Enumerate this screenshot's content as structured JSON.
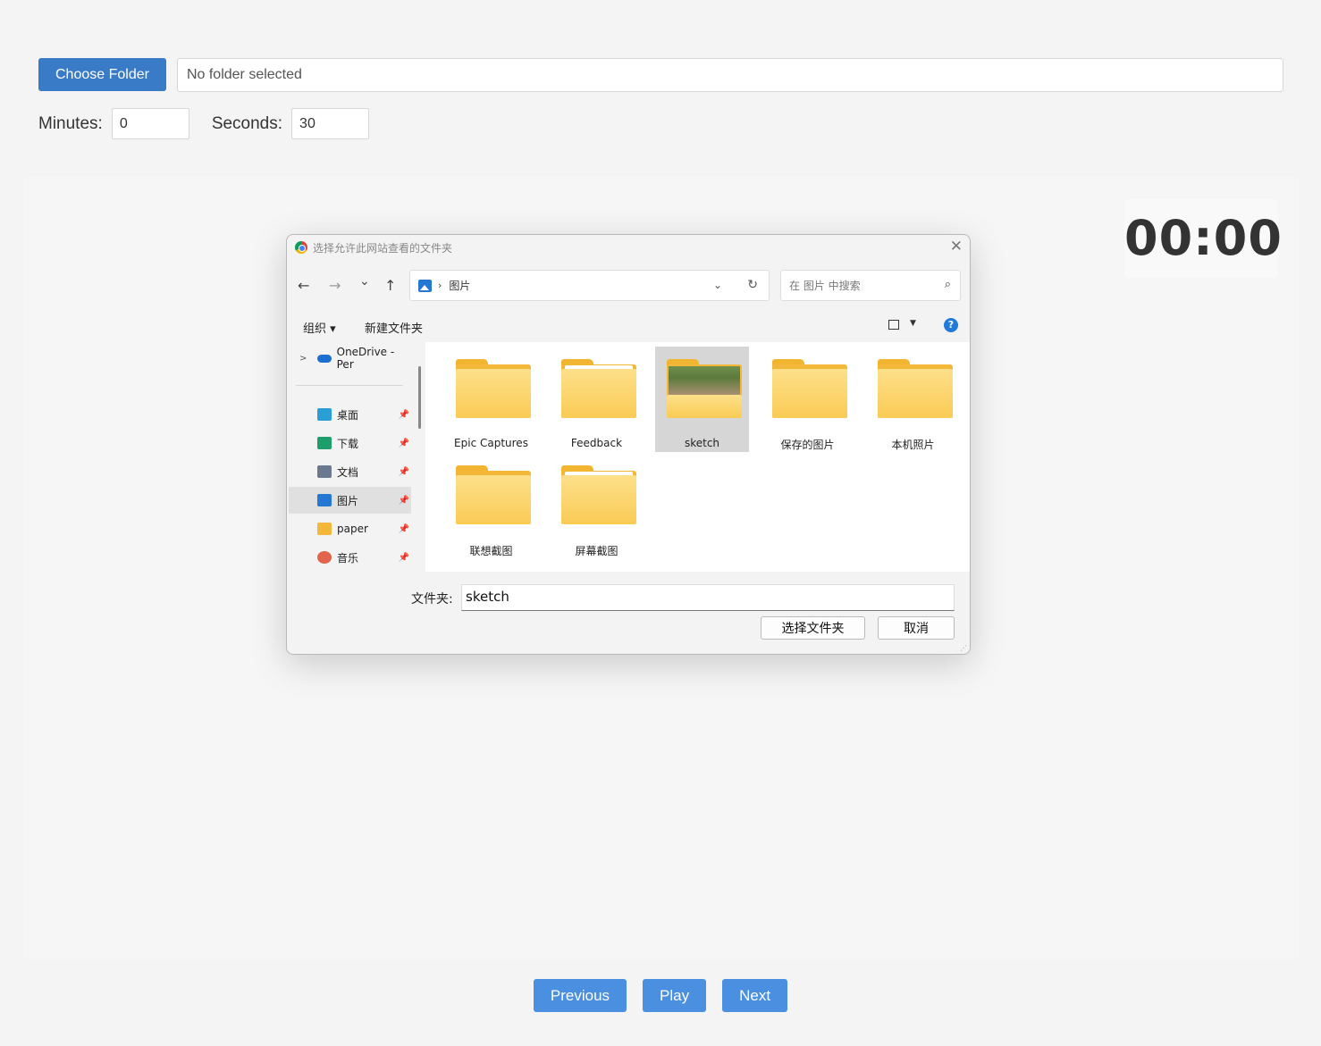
{
  "top": {
    "choose_folder_label": "Choose Folder",
    "folder_display": "No folder selected"
  },
  "time": {
    "minutes_label": "Minutes:",
    "minutes_value": "0",
    "seconds_label": "Seconds:",
    "seconds_value": "30"
  },
  "timer": {
    "value": "00:00"
  },
  "nav": {
    "previous": "Previous",
    "play": "Play",
    "next": "Next"
  },
  "dialog": {
    "title": "选择允许此网站查看的文件夹",
    "close_glyph": "✕",
    "nav_glyphs": {
      "back": "←",
      "forward": "→",
      "recent": "⌄",
      "up": "↑",
      "refresh": "↻",
      "search": "⌕",
      "chevron": "⌄"
    },
    "breadcrumb_sep": "›",
    "address": "图片",
    "search_placeholder": "在 图片 中搜索",
    "toolbar": {
      "organize": "组织 ▾",
      "new_folder": "新建文件夹",
      "help": "?"
    },
    "sidebar": {
      "onedrive": "OneDrive - Per",
      "items": [
        {
          "label": "桌面",
          "icon": "desktop-icon",
          "color": "#2a9fd6"
        },
        {
          "label": "下载",
          "icon": "download-icon",
          "color": "#1e9e6a"
        },
        {
          "label": "文档",
          "icon": "document-icon",
          "color": "#6b7a8f"
        },
        {
          "label": "图片",
          "icon": "pictures-icon",
          "color": "#2478d4"
        },
        {
          "label": "paper",
          "icon": "folder-icon",
          "color": "#f3b73a"
        },
        {
          "label": "音乐",
          "icon": "music-icon",
          "color": "#e0654b"
        }
      ]
    },
    "folders": [
      {
        "label": "Epic Captures",
        "type": "plain"
      },
      {
        "label": "Feedback",
        "type": "paper"
      },
      {
        "label": "sketch",
        "type": "photo"
      },
      {
        "label": "保存的图片",
        "type": "plain"
      },
      {
        "label": "本机照片",
        "type": "plain"
      },
      {
        "label": "联想截图",
        "type": "plain"
      },
      {
        "label": "屏幕截图",
        "type": "paper"
      }
    ],
    "folder_field_label": "文件夹:",
    "folder_field_value": "sketch",
    "select_button": "选择文件夹",
    "cancel_button": "取消"
  }
}
